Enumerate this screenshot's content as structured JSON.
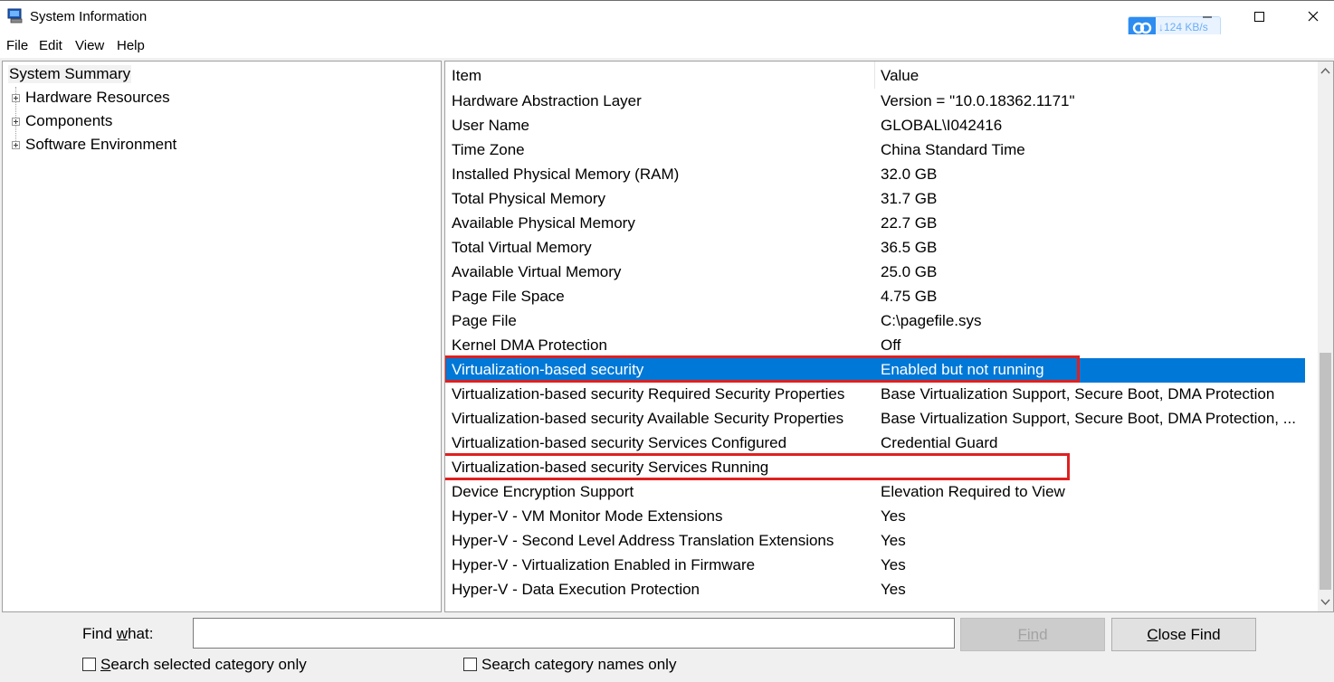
{
  "window": {
    "title": "System Information",
    "net_speed": "↓124 KB/s"
  },
  "menu": [
    "File",
    "Edit",
    "View",
    "Help"
  ],
  "tree": {
    "root": "System Summary",
    "children": [
      "Hardware Resources",
      "Components",
      "Software Environment"
    ]
  },
  "list": {
    "headers": {
      "item": "Item",
      "value": "Value"
    },
    "selected_index": 11,
    "highlighted_indices": [
      11,
      15
    ],
    "rows": [
      {
        "item": "Hardware Abstraction Layer",
        "value": "Version = \"10.0.18362.1171\""
      },
      {
        "item": "User Name",
        "value": "GLOBAL\\I042416"
      },
      {
        "item": "Time Zone",
        "value": "China Standard Time"
      },
      {
        "item": "Installed Physical Memory (RAM)",
        "value": "32.0 GB"
      },
      {
        "item": "Total Physical Memory",
        "value": "31.7 GB"
      },
      {
        "item": "Available Physical Memory",
        "value": "22.7 GB"
      },
      {
        "item": "Total Virtual Memory",
        "value": "36.5 GB"
      },
      {
        "item": "Available Virtual Memory",
        "value": "25.0 GB"
      },
      {
        "item": "Page File Space",
        "value": "4.75 GB"
      },
      {
        "item": "Page File",
        "value": "C:\\pagefile.sys"
      },
      {
        "item": "Kernel DMA Protection",
        "value": "Off"
      },
      {
        "item": "Virtualization-based security",
        "value": "Enabled but not running"
      },
      {
        "item": "Virtualization-based security Required Security Properties",
        "value": "Base Virtualization Support, Secure Boot, DMA Protection"
      },
      {
        "item": "Virtualization-based security Available Security Properties",
        "value": "Base Virtualization Support, Secure Boot, DMA Protection, ..."
      },
      {
        "item": "Virtualization-based security Services Configured",
        "value": "Credential Guard"
      },
      {
        "item": "Virtualization-based security Services Running",
        "value": ""
      },
      {
        "item": "Device Encryption Support",
        "value": "Elevation Required to View"
      },
      {
        "item": "Hyper-V - VM Monitor Mode Extensions",
        "value": "Yes"
      },
      {
        "item": "Hyper-V - Second Level Address Translation Extensions",
        "value": "Yes"
      },
      {
        "item": "Hyper-V - Virtualization Enabled in Firmware",
        "value": "Yes"
      },
      {
        "item": "Hyper-V - Data Execution Protection",
        "value": "Yes"
      }
    ]
  },
  "find": {
    "label_pre": "Find ",
    "label_key": "w",
    "label_post": "hat:",
    "value": "",
    "find_button_key": "Fin",
    "find_button_rest": "d",
    "close_button_key": "C",
    "close_button_rest": "lose Find",
    "check1_key": "S",
    "check1_rest": "earch selected category only",
    "check2_pre": "Sea",
    "check2_key": "r",
    "check2_rest": "ch category names only"
  },
  "colors": {
    "selection": "#0078d7",
    "annotation": "#e02020"
  },
  "icons": [
    "app-icon",
    "cloud-icon",
    "minimize-icon",
    "maximize-icon",
    "close-icon",
    "expand-plus-icon",
    "scroll-up-icon",
    "scroll-down-icon"
  ]
}
